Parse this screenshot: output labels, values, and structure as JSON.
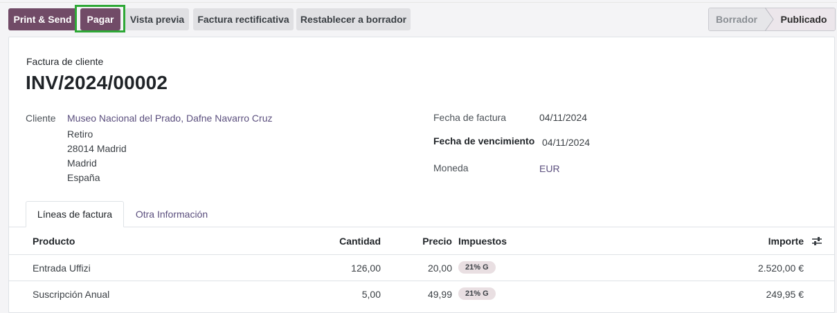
{
  "toolbar": {
    "print_send": "Print & Send",
    "pay": "Pagar",
    "preview": "Vista previa",
    "credit_note": "Factura rectificativa",
    "reset_draft": "Restablecer a borrador"
  },
  "statusbar": {
    "draft": "Borrador",
    "posted": "Publicado",
    "current": "Publicado"
  },
  "document": {
    "type": "Factura de cliente",
    "name": "INV/2024/00002"
  },
  "customer": {
    "label": "Cliente",
    "name": "Museo Nacional del Prado, Dafne Navarro Cruz",
    "address": [
      "Retiro",
      "28014 Madrid",
      "Madrid",
      "España"
    ]
  },
  "fields": {
    "invoice_date_label": "Fecha de factura",
    "invoice_date": "04/11/2024",
    "due_date_label": "Fecha de vencimiento",
    "due_date": "04/11/2024",
    "currency_label": "Moneda",
    "currency": "EUR"
  },
  "tabs": [
    {
      "label": "Líneas de factura",
      "active": true
    },
    {
      "label": "Otra Información",
      "active": false
    }
  ],
  "lines_table": {
    "headers": {
      "product": "Producto",
      "quantity": "Cantidad",
      "price": "Precio",
      "taxes": "Impuestos",
      "amount": "Importe"
    },
    "rows": [
      {
        "product": "Entrada Uffizi",
        "quantity": "126,00",
        "price": "20,00",
        "tax": "21% G",
        "amount": "2.520,00 €"
      },
      {
        "product": "Suscripción Anual",
        "quantity": "5,00",
        "price": "49,99",
        "tax": "21% G",
        "amount": "249,95 €"
      }
    ]
  },
  "icons": {
    "optional_columns": "sliders-icon",
    "stage_separator": "chevron-right-icon"
  },
  "colors": {
    "primary": "#714b67",
    "highlight": "#2ea836",
    "link": "#5b4f7e",
    "badge_bg": "#e9dfe2"
  }
}
